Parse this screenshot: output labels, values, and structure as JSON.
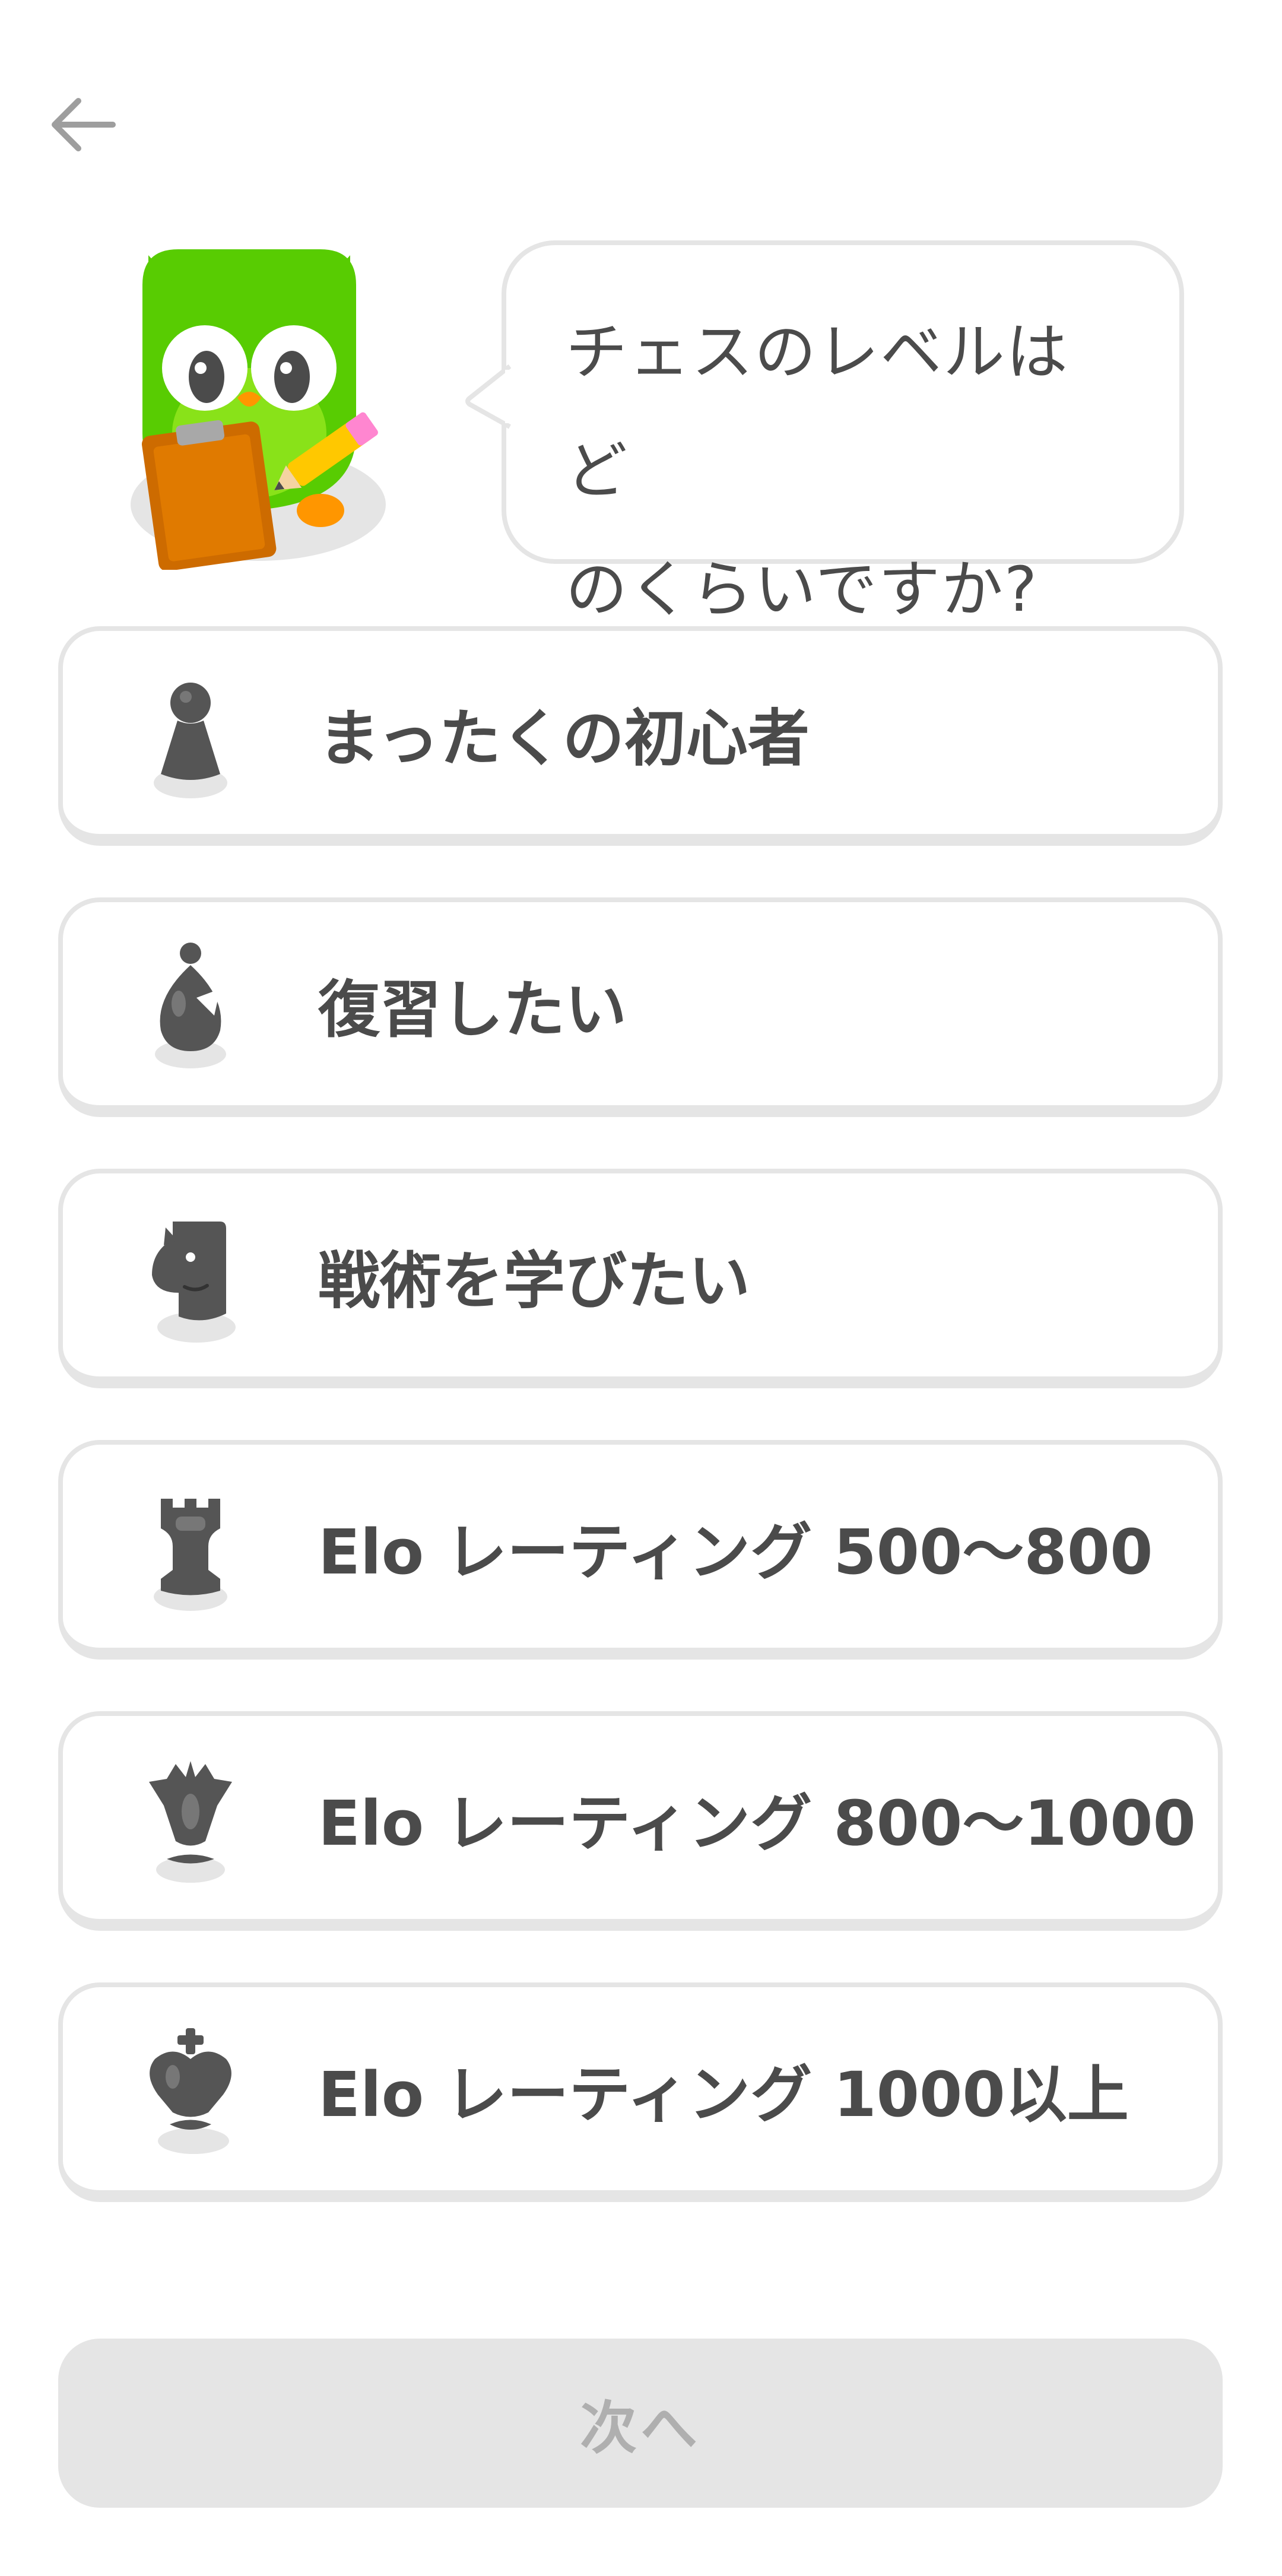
{
  "header": {
    "back_icon": "arrow-left-icon"
  },
  "prompt": {
    "mascot_icon": "owl-mascot-with-clipboard-icon",
    "line1": "チェスのレベルはど",
    "line2": "のくらいですか?"
  },
  "options": [
    {
      "icon": "pawn-icon",
      "label": "まったくの初心者"
    },
    {
      "icon": "bishop-icon",
      "label": "復習したい"
    },
    {
      "icon": "knight-icon",
      "label": "戦術を学びたい"
    },
    {
      "icon": "rook-icon",
      "label": "Elo レーティング 500〜800"
    },
    {
      "icon": "queen-icon",
      "label": "Elo レーティング 800〜1000"
    },
    {
      "icon": "king-icon",
      "label": "Elo レーティング 1000以上"
    }
  ],
  "footer": {
    "next_label": "次へ",
    "next_enabled": false
  },
  "colors": {
    "owl_green": "#58cc02",
    "border_gray": "#e5e5e5",
    "text_gray": "#4b4b4b",
    "piece_gray": "#555555",
    "disabled_text": "#afafaf"
  }
}
